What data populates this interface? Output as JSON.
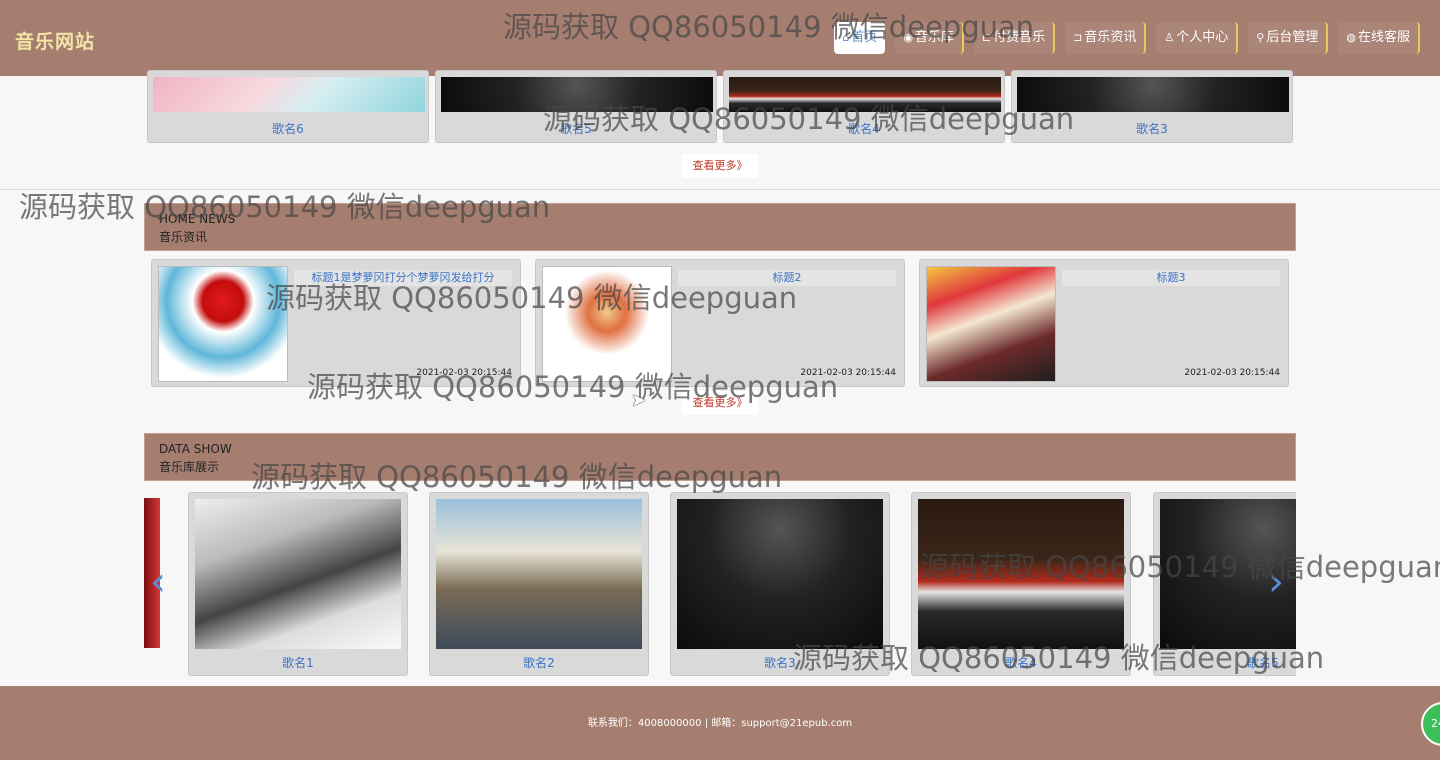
{
  "nav": {
    "brand": "音乐网站",
    "links": [
      {
        "label": "首页",
        "icon": "home-icon",
        "glyph": "⌂"
      },
      {
        "label": "音乐库",
        "icon": "globe-icon",
        "glyph": "◉"
      },
      {
        "label": "付费音乐",
        "icon": "tag-icon",
        "glyph": "⊏"
      },
      {
        "label": "音乐资讯",
        "icon": "doc-icon",
        "glyph": "⊐"
      },
      {
        "label": "个人中心",
        "icon": "user-icon",
        "glyph": "♙"
      },
      {
        "label": "后台管理",
        "icon": "link-icon",
        "glyph": "⚲"
      },
      {
        "label": "在线客服",
        "icon": "chat-icon",
        "glyph": "◍"
      }
    ]
  },
  "top_songs": [
    "歌名6",
    "歌名5",
    "歌名4",
    "歌名3"
  ],
  "more_label": "查看更多》",
  "news": {
    "title_en": "HOME NEWS",
    "title_zh": "音乐资讯",
    "items": [
      {
        "title": "标题1是梦萝冈打分个梦萝冈发给打分",
        "date": "2021-02-03 20:15:44"
      },
      {
        "title": "标题2",
        "date": "2021-02-03 20:15:44"
      },
      {
        "title": "标题3",
        "date": "2021-02-03 20:15:44"
      }
    ],
    "more_label": "查看更多》"
  },
  "show": {
    "title_en": "DATA SHOW",
    "title_zh": "音乐库展示",
    "items": [
      "歌名1",
      "歌名2",
      "歌名3",
      "歌名4",
      "歌名5"
    ],
    "prev_glyph": "‹",
    "next_glyph": "›"
  },
  "footer": {
    "text": "联系我们：4008000000 | 邮箱：support@21epub.com"
  },
  "chat_badge": "24",
  "watermark": "源码获取 QQ86050149 微信deepguan"
}
